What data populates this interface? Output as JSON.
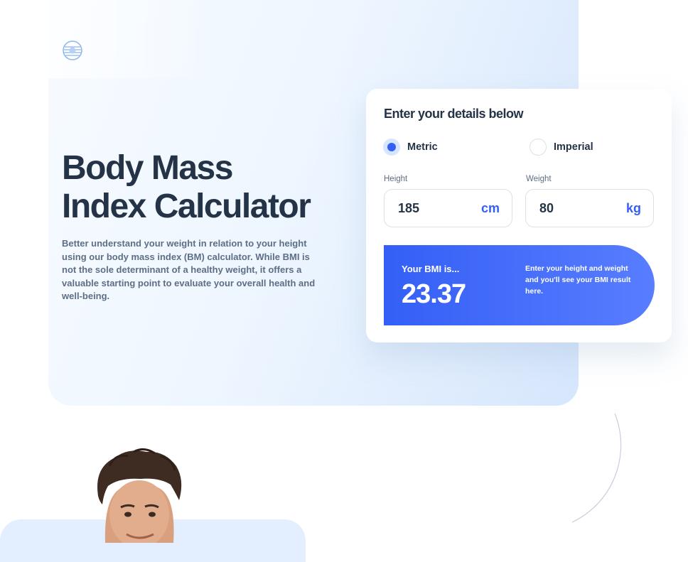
{
  "hero": {
    "title_line1": "Body Mass",
    "title_line2": "Index Calculator",
    "intro": "Better understand your weight in relation to your height using our body mass index (BM) calculator. While BMI is not the sole determinant of a healthy weight, it offers a valuable starting point to evaluate your overall health and well-being."
  },
  "logo": {
    "icon": "logo-icon"
  },
  "calculator": {
    "title": "Enter your details below",
    "units": {
      "metric_label": "Metric",
      "imperial_label": "Imperial",
      "selected": "Metric"
    },
    "height": {
      "label": "Height",
      "value": "185",
      "unit": "cm"
    },
    "weight": {
      "label": "Weight",
      "value": "80",
      "unit": "kg"
    },
    "result": {
      "label": "Your BMI is...",
      "value": "23.37",
      "note": "Enter your height and weight and you'll see your BMI result here."
    }
  },
  "colors": {
    "primary": "#345FF6",
    "heading": "#253347",
    "body_text": "#5E6E85",
    "border": "#D8E2E7",
    "radio_ring": "#D6E6FE",
    "photo_bg": "#E3EFFF"
  }
}
